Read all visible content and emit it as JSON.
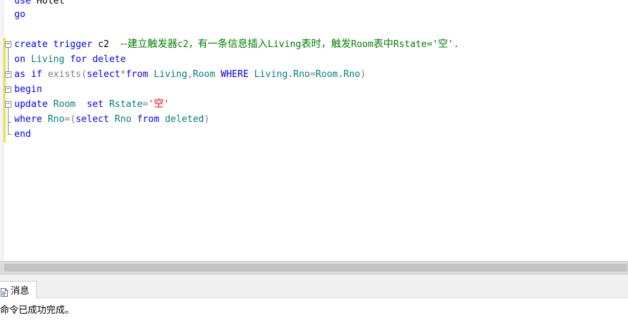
{
  "editor": {
    "lines": [
      [
        {
          "t": "use",
          "c": "kw"
        },
        {
          "t": " Hotel",
          "c": ""
        }
      ],
      [
        {
          "t": "go",
          "c": "kw"
        }
      ],
      [
        {
          "t": "create",
          "c": "kw"
        },
        {
          "t": " ",
          "c": ""
        },
        {
          "t": "trigger",
          "c": "kw"
        },
        {
          "t": " c2  ",
          "c": ""
        },
        {
          "t": "--建立触发器",
          "c": "cmt cn"
        },
        {
          "t": "c2，",
          "c": "cmt"
        },
        {
          "t": "有一条信息插入",
          "c": "cmt cn"
        },
        {
          "t": "Living",
          "c": "cmt"
        },
        {
          "t": "表时，触发",
          "c": "cmt cn"
        },
        {
          "t": "Room",
          "c": "cmt"
        },
        {
          "t": "表中",
          "c": "cmt cn"
        },
        {
          "t": "Rstate='",
          "c": "cmt"
        },
        {
          "t": "空",
          "c": "cmt cn"
        },
        {
          "t": "'.",
          "c": "cmt"
        }
      ],
      [
        {
          "t": "on",
          "c": "kw"
        },
        {
          "t": " Living ",
          "c": "teal"
        },
        {
          "t": "for",
          "c": "kw"
        },
        {
          "t": " ",
          "c": ""
        },
        {
          "t": "delete",
          "c": "kw"
        }
      ],
      [
        {
          "t": "as",
          "c": "kw"
        },
        {
          "t": " ",
          "c": ""
        },
        {
          "t": "if",
          "c": "kw"
        },
        {
          "t": " ",
          "c": ""
        },
        {
          "t": "exists",
          "c": "gry"
        },
        {
          "t": "(",
          "c": "gry"
        },
        {
          "t": "select",
          "c": "kw"
        },
        {
          "t": "*",
          "c": "gry"
        },
        {
          "t": "from",
          "c": "kw"
        },
        {
          "t": " Living",
          "c": "teal"
        },
        {
          "t": ",",
          "c": "gry"
        },
        {
          "t": "Room ",
          "c": "teal"
        },
        {
          "t": "WHERE",
          "c": "kw"
        },
        {
          "t": " Living.Rno",
          "c": "teal"
        },
        {
          "t": "=",
          "c": "gry"
        },
        {
          "t": "Room.Rno",
          "c": "teal"
        },
        {
          "t": ")",
          "c": "gry"
        }
      ],
      [
        {
          "t": "begin",
          "c": "kw"
        }
      ],
      [
        {
          "t": "update",
          "c": "kw"
        },
        {
          "t": " Room  ",
          "c": "teal"
        },
        {
          "t": "set",
          "c": "kw"
        },
        {
          "t": " Rstate",
          "c": "teal"
        },
        {
          "t": "=",
          "c": "gry"
        },
        {
          "t": "'",
          "c": "str"
        },
        {
          "t": "空",
          "c": "str cn"
        },
        {
          "t": "'",
          "c": "str"
        }
      ],
      [
        {
          "t": "where",
          "c": "kw"
        },
        {
          "t": " Rno",
          "c": "teal"
        },
        {
          "t": "=(",
          "c": "gry"
        },
        {
          "t": "select",
          "c": "kw"
        },
        {
          "t": " Rno ",
          "c": "teal"
        },
        {
          "t": "from",
          "c": "kw"
        },
        {
          "t": " deleted",
          "c": "teal"
        },
        {
          "t": ")",
          "c": "gry"
        }
      ],
      [
        {
          "t": "end",
          "c": "kw"
        }
      ]
    ]
  },
  "results": {
    "tab_label": "消息",
    "message": "命令已成功完成。"
  },
  "icons": {
    "fold_expanded": "collapse-minus-icon",
    "messages_tab": "message-document-icon"
  },
  "colors": {
    "keyword": "#0000ff",
    "string": "#ff0000",
    "comment": "#008000",
    "operator": "#808080",
    "identifier": "#008080",
    "change_bar": "#ece24a"
  }
}
